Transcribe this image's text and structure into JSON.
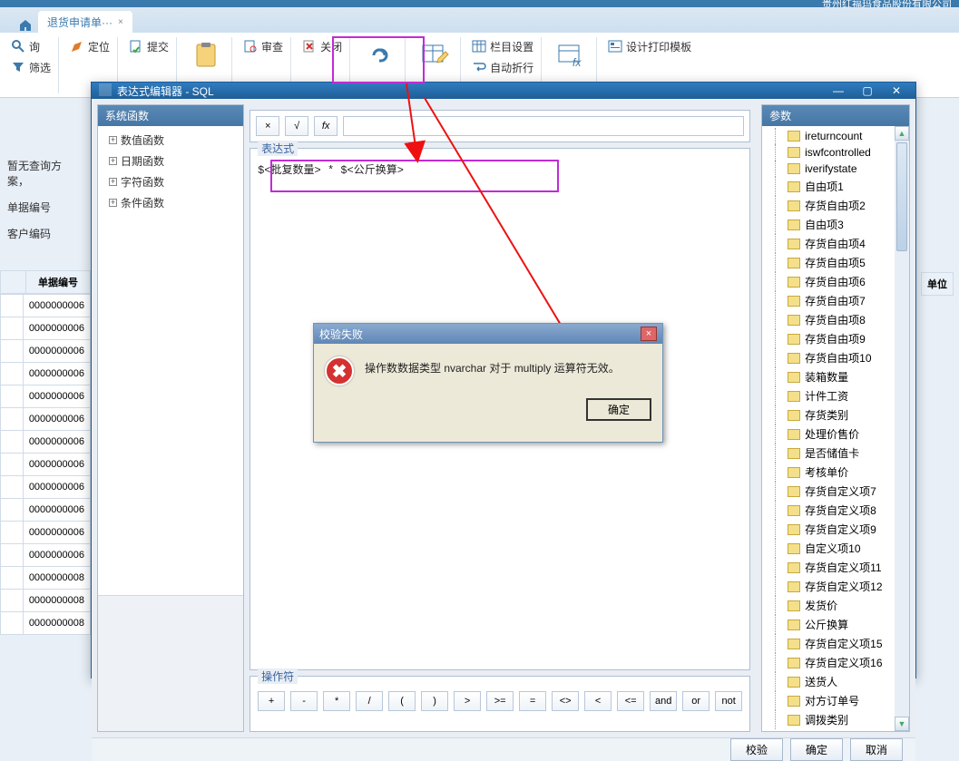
{
  "app_title_suffix": "贵州红福玛食品股份有限公司",
  "tab": {
    "label": "退货申请单···",
    "close": "×"
  },
  "ribbon": {
    "query": "询",
    "locate": "定位",
    "filter": "筛选",
    "submit": "提交",
    "audit": "审查",
    "close": "关闭",
    "column_setting": "栏目设置",
    "auto_wrap": "自动折行",
    "print_template": "设计打印模板"
  },
  "left_nav": {
    "no_plan": "暂无查询方案，",
    "bill_no": "单据编号",
    "cust_code": "客户编码"
  },
  "grid": {
    "header": "单据编号",
    "rows": [
      "0000000006",
      "0000000006",
      "0000000006",
      "0000000006",
      "0000000006",
      "0000000006",
      "0000000006",
      "0000000006",
      "0000000006",
      "0000000006",
      "0000000006",
      "0000000006",
      "0000000008",
      "0000000008",
      "0000000008"
    ],
    "unit_header": "单位"
  },
  "editor": {
    "title": "表达式编辑器 - SQL",
    "sys_funcs_title": "系统函数",
    "func_nodes": [
      "数值函数",
      "日期函数",
      "字符函数",
      "条件函数"
    ],
    "tool_x": "×",
    "tool_sqrt": "√",
    "tool_fx": "fx",
    "expr_label": "表达式",
    "expr_text": "$<批复数量> * $<公斤换算>",
    "ops_label": "操作符",
    "ops": [
      "+",
      "-",
      "*",
      "/",
      "(",
      ")",
      ">",
      ">=",
      "=",
      "<>",
      "<",
      "<=",
      "and",
      "or",
      "not"
    ],
    "params_title": "参数",
    "params": [
      "ireturncount",
      "iswfcontrolled",
      "iverifystate",
      "自由项1",
      "存货自由项2",
      "自由项3",
      "存货自由项4",
      "存货自由项5",
      "存货自由项6",
      "存货自由项7",
      "存货自由项8",
      "存货自由项9",
      "存货自由项10",
      "装箱数量",
      "计件工资",
      "存货类别",
      "处理价售价",
      "是否储值卡",
      "考核单价",
      "存货自定义项7",
      "存货自定义项8",
      "存货自定义项9",
      "自定义项10",
      "存货自定义项11",
      "存货自定义项12",
      "发货价",
      "公斤换算",
      "存货自定义项15",
      "存货自定义项16",
      "送货人",
      "对方订单号",
      "调拨类别"
    ],
    "footer": {
      "verify": "校验",
      "ok": "确定",
      "cancel": "取消"
    }
  },
  "error": {
    "title": "校验失败",
    "message": "操作数数据类型 nvarchar 对于 multiply 运算符无效。",
    "ok": "确定"
  }
}
